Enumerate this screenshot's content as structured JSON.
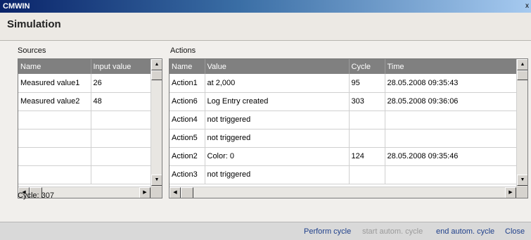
{
  "window": {
    "title": "CMWIN",
    "close_glyph": "x"
  },
  "header": {
    "title": "Simulation"
  },
  "sources": {
    "label": "Sources",
    "columns": [
      "Name",
      "Input value"
    ],
    "rows": [
      [
        "Measured value1",
        "26"
      ],
      [
        "Measured value2",
        "48"
      ],
      [
        "",
        ""
      ],
      [
        "",
        ""
      ],
      [
        "",
        ""
      ],
      [
        "",
        ""
      ]
    ]
  },
  "actions": {
    "label": "Actions",
    "columns": [
      "Name",
      "Value",
      "Cycle",
      "Time"
    ],
    "rows": [
      [
        "Action1",
        " at 2,000",
        "95",
        "28.05.2008 09:35:43"
      ],
      [
        "Action6",
        "Log Entry created",
        "303",
        "28.05.2008 09:36:06"
      ],
      [
        "Action4",
        "not triggered",
        "",
        ""
      ],
      [
        "Action5",
        "not triggered",
        "",
        ""
      ],
      [
        "Action2",
        "Color: 0",
        "124",
        "28.05.2008 09:35:46"
      ],
      [
        "Action3",
        "not triggered",
        "",
        ""
      ]
    ]
  },
  "status": {
    "cycle_text": "Cycle: 307"
  },
  "footer": {
    "perform_cycle": "Perform cycle",
    "start_autom_cycle": "start autom. cycle",
    "end_autom_cycle": "end autom. cycle",
    "close": "Close"
  },
  "icons": {
    "scroll_up": "▲",
    "scroll_down": "▼",
    "scroll_left": "◀",
    "scroll_right": "▶"
  },
  "colors": {
    "header_row_bg": "#808080",
    "link_text": "#1e3f8a",
    "disabled_text": "#9a9a9a"
  }
}
